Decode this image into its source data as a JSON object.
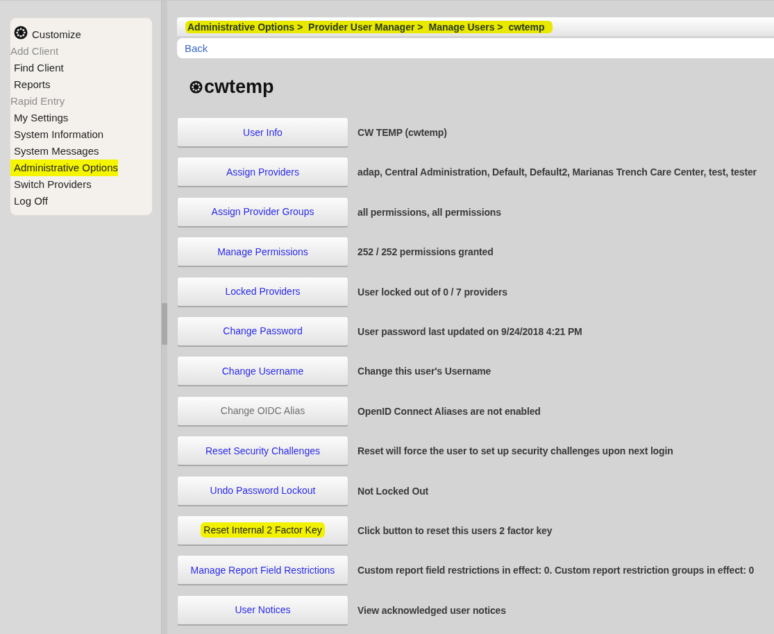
{
  "sidebar": {
    "items": [
      {
        "label": "Customize",
        "kind": "header",
        "disabled": false,
        "highlighted": false
      },
      {
        "label": "Add Client",
        "kind": "link",
        "disabled": true,
        "highlighted": false
      },
      {
        "label": "Find Client",
        "kind": "link",
        "disabled": false,
        "highlighted": false
      },
      {
        "label": "Reports",
        "kind": "link",
        "disabled": false,
        "highlighted": false
      },
      {
        "label": "Rapid Entry",
        "kind": "link",
        "disabled": true,
        "highlighted": false
      },
      {
        "label": "My Settings",
        "kind": "link",
        "disabled": false,
        "highlighted": false
      },
      {
        "label": "System Information",
        "kind": "link",
        "disabled": false,
        "highlighted": false
      },
      {
        "label": "System Messages",
        "kind": "link",
        "disabled": false,
        "highlighted": false
      },
      {
        "label": "Administrative Options",
        "kind": "link",
        "disabled": false,
        "highlighted": true
      },
      {
        "label": "Switch Providers",
        "kind": "link",
        "disabled": false,
        "highlighted": false
      },
      {
        "label": "Log Off",
        "kind": "link",
        "disabled": false,
        "highlighted": false
      }
    ]
  },
  "breadcrumb": {
    "highlighted": true,
    "separator": ">",
    "items": [
      "Administrative Options",
      "Provider User Manager",
      "Manage Users",
      "cwtemp"
    ]
  },
  "back_link": "Back",
  "title": "cwtemp",
  "actions": [
    {
      "button": "User Info",
      "disabled": false,
      "highlighted": false,
      "description": "CW TEMP (cwtemp)"
    },
    {
      "button": "Assign Providers",
      "disabled": false,
      "highlighted": false,
      "description": "adap, Central Administration, Default, Default2, Marianas Trench Care Center, test, tester"
    },
    {
      "button": "Assign Provider Groups",
      "disabled": false,
      "highlighted": false,
      "description": "all permissions, all permissions"
    },
    {
      "button": "Manage Permissions",
      "disabled": false,
      "highlighted": false,
      "description": "252 / 252 permissions granted"
    },
    {
      "button": "Locked Providers",
      "disabled": false,
      "highlighted": false,
      "description": "User locked out of 0 / 7 providers"
    },
    {
      "button": "Change Password",
      "disabled": false,
      "highlighted": false,
      "description": "User password last updated on 9/24/2018 4:21 PM"
    },
    {
      "button": "Change Username",
      "disabled": false,
      "highlighted": false,
      "description": "Change this user's Username"
    },
    {
      "button": "Change OIDC Alias",
      "disabled": true,
      "highlighted": false,
      "description": "OpenID Connect Aliases are not enabled"
    },
    {
      "button": "Reset Security Challenges",
      "disabled": false,
      "highlighted": false,
      "description": "Reset will force the user to set up security challenges upon next login"
    },
    {
      "button": "Undo Password Lockout",
      "disabled": false,
      "highlighted": false,
      "description": "Not Locked Out"
    },
    {
      "button": "Reset Internal 2 Factor Key",
      "disabled": false,
      "highlighted": true,
      "description": "Click button to reset this users 2 factor key"
    },
    {
      "button": "Manage Report Field Restrictions",
      "disabled": false,
      "highlighted": false,
      "description": "Custom report field restrictions in effect: 0. Custom report restriction groups in effect: 0"
    },
    {
      "button": "User Notices",
      "disabled": false,
      "highlighted": false,
      "description": "View acknowledged user notices"
    }
  ]
}
